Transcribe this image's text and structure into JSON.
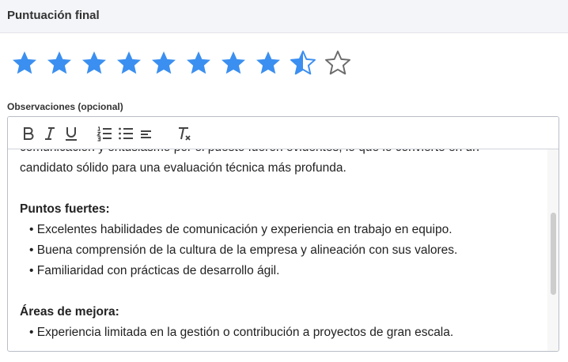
{
  "header": {
    "title": "Puntuación final"
  },
  "rating": {
    "value": 8.5,
    "max": 10,
    "filled_color": "#3b8ff0",
    "empty_color": "#6b6b6b"
  },
  "field": {
    "label": "Observaciones (opcional)"
  },
  "toolbar": {
    "buttons": [
      {
        "name": "bold",
        "icon": "bold-icon"
      },
      {
        "name": "italic",
        "icon": "italic-icon"
      },
      {
        "name": "underline",
        "icon": "underline-icon"
      },
      {
        "name": "ordered-list",
        "icon": "ordered-list-icon"
      },
      {
        "name": "bullet-list",
        "icon": "bullet-list-icon"
      },
      {
        "name": "align",
        "icon": "align-left-icon"
      },
      {
        "name": "clear-format",
        "icon": "clear-format-icon"
      }
    ]
  },
  "editor": {
    "paragraph_line1": "comunicación y entusiasmo por el puesto fueron evidentes, lo que lo convierte en un",
    "paragraph_line2": "candidato sólido para una evaluación técnica más profunda.",
    "strengths_heading": "Puntos fuertes:",
    "strengths": [
      "Excelentes habilidades de comunicación y experiencia en trabajo en equipo.",
      "Buena comprensión de la cultura de la empresa y alineación con sus valores.",
      "Familiaridad con prácticas de desarrollo ágil."
    ],
    "improvements_heading": "Áreas de mejora:",
    "improvements": [
      "Experiencia limitada en la gestión o contribución a proyectos de gran escala."
    ]
  }
}
